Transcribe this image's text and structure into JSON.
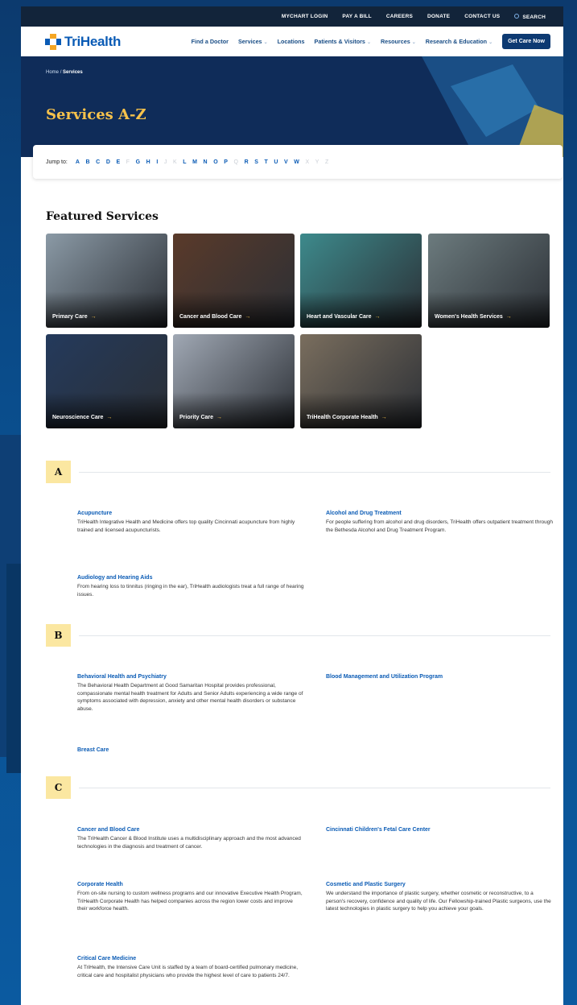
{
  "utility_nav": [
    "MYCHART LOGIN",
    "PAY A BILL",
    "CAREERS",
    "DONATE",
    "CONTACT US",
    "SEARCH"
  ],
  "logo": "TriHealth",
  "main_nav": [
    {
      "label": "Find a Doctor",
      "dropdown": false
    },
    {
      "label": "Services",
      "dropdown": true
    },
    {
      "label": "Locations",
      "dropdown": false
    },
    {
      "label": "Patients & Visitors",
      "dropdown": true
    },
    {
      "label": "Resources",
      "dropdown": true
    },
    {
      "label": "Research & Education",
      "dropdown": true
    }
  ],
  "cta": "Get Care Now",
  "breadcrumb": {
    "home": "Home",
    "sep": "/",
    "current": "Services"
  },
  "page_title": "Services A-Z",
  "jump": {
    "label": "Jump to:",
    "letters": [
      {
        "l": "A",
        "on": true
      },
      {
        "l": "B",
        "on": true
      },
      {
        "l": "C",
        "on": true
      },
      {
        "l": "D",
        "on": true
      },
      {
        "l": "E",
        "on": true
      },
      {
        "l": "F",
        "on": false
      },
      {
        "l": "G",
        "on": true
      },
      {
        "l": "H",
        "on": true
      },
      {
        "l": "I",
        "on": true
      },
      {
        "l": "J",
        "on": false
      },
      {
        "l": "K",
        "on": false
      },
      {
        "l": "L",
        "on": true
      },
      {
        "l": "M",
        "on": true
      },
      {
        "l": "N",
        "on": true
      },
      {
        "l": "O",
        "on": true
      },
      {
        "l": "P",
        "on": true
      },
      {
        "l": "Q",
        "on": false
      },
      {
        "l": "R",
        "on": true
      },
      {
        "l": "S",
        "on": true
      },
      {
        "l": "T",
        "on": true
      },
      {
        "l": "U",
        "on": true
      },
      {
        "l": "V",
        "on": true
      },
      {
        "l": "W",
        "on": true
      },
      {
        "l": "X",
        "on": false
      },
      {
        "l": "Y",
        "on": false
      },
      {
        "l": "Z",
        "on": false
      }
    ]
  },
  "featured": {
    "title": "Featured Services",
    "cards": [
      {
        "label": "Primary Care",
        "color": "#8b9aa6"
      },
      {
        "label": "Cancer and Blood Care",
        "color": "#5a3a2a"
      },
      {
        "label": "Heart and Vascular Care",
        "color": "#3d8a8c"
      },
      {
        "label": "Women's Health Services",
        "color": "#6c7b7e"
      },
      {
        "label": "Neuroscience Care",
        "color": "#243a5c"
      },
      {
        "label": "Priority Care",
        "color": "#a0a8b4"
      },
      {
        "label": "TriHealth Corporate Health",
        "color": "#7a6e5e"
      }
    ]
  },
  "sections": [
    {
      "letter": "A",
      "entries": [
        {
          "title": "Acupuncture",
          "desc": "TriHealth Integrative Health and Medicine offers top quality Cincinnati acupuncture from highly trained and licensed acupuncturists."
        },
        {
          "title": "Alcohol and Drug Treatment",
          "desc": "For people suffering from alcohol and drug disorders, TriHealth offers outpatient treatment through the Bethesda Alcohol and Drug Treatment Program."
        },
        {
          "title": "Audiology and Hearing Aids",
          "desc": "From hearing loss to tinnitus (ringing in the ear), TriHealth audiologists treat a full range of hearing issues."
        }
      ]
    },
    {
      "letter": "B",
      "entries": [
        {
          "title": "Behavioral Health and Psychiatry",
          "desc": "The Behavioral Health Department at Good Samaritan Hospital provides professional, compassionate mental health treatment for Adults and Senior Adults experiencing a wide range of symptoms associated with depression, anxiety and other mental health disorders or substance abuse."
        },
        {
          "title": "Blood Management and Utilization Program",
          "desc": ""
        },
        {
          "title": "Breast Care",
          "desc": ""
        }
      ]
    },
    {
      "letter": "C",
      "entries": [
        {
          "title": "Cancer and Blood Care",
          "desc": "The TriHealth Cancer & Blood Institute uses a multidisciplinary approach and the most advanced technologies in the diagnosis and treatment of cancer."
        },
        {
          "title": "Cincinnati Children's Fetal Care Center",
          "desc": ""
        },
        {
          "title": "Corporate Health",
          "desc": "From on-site nursing to custom wellness programs and our innovative Executive Health Program, TriHealth Corporate Health has helped companies across the region lower costs and improve their workforce health."
        },
        {
          "title": "Cosmetic and Plastic Surgery",
          "desc": "We understand the importance of plastic surgery, whether cosmetic or reconstructive, to a person's recovery, confidence and quality of life. Our Fellowship-trained Plastic surgeons, use the latest technologies in plastic surgery to help you achieve your goals."
        },
        {
          "title": "Critical Care Medicine",
          "desc": "At TriHealth, the Intensive Care Unit is staffed by a team of board-certified pulmonary medicine, critical care and hospitalist physicians who provide the highest level of care to patients 24/7."
        }
      ]
    }
  ]
}
